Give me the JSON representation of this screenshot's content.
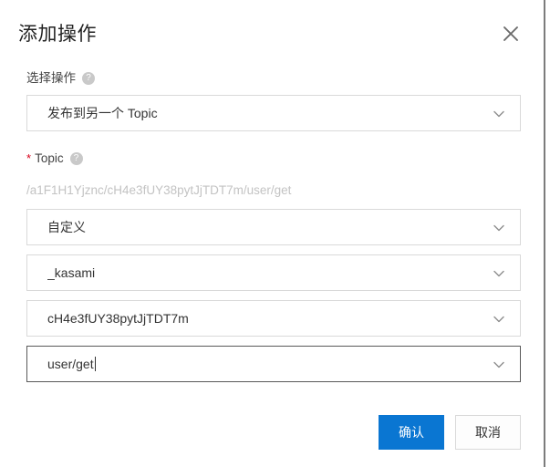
{
  "dialog": {
    "title": "添加操作",
    "close_icon": "close-icon"
  },
  "form": {
    "action_field": {
      "label": "选择操作",
      "help_icon": "?",
      "value": "发布到另一个 Topic",
      "caret_icon": "chevron-down-icon"
    },
    "topic_field": {
      "required_marker": "*",
      "label": "Topic",
      "help_icon": "?",
      "path_preview": "/a1F1H1Yjznc/cH4e3fUY38pytJjTDT7m/user/get",
      "segments": [
        {
          "name": "topic-mode-select",
          "value": "自定义"
        },
        {
          "name": "topic-instance-select",
          "value": "_kasami"
        },
        {
          "name": "topic-id-select",
          "value": "cH4e3fUY38pytJjTDT7m"
        },
        {
          "name": "topic-path-select",
          "value": "user/get"
        }
      ]
    }
  },
  "footer": {
    "confirm_label": "确认",
    "cancel_label": "取消"
  },
  "colors": {
    "primary": "#0a76d2",
    "required": "#d9001b",
    "border": "#d9d9d9",
    "focused_border": "#595959",
    "hint_text": "#c3c3c3"
  }
}
